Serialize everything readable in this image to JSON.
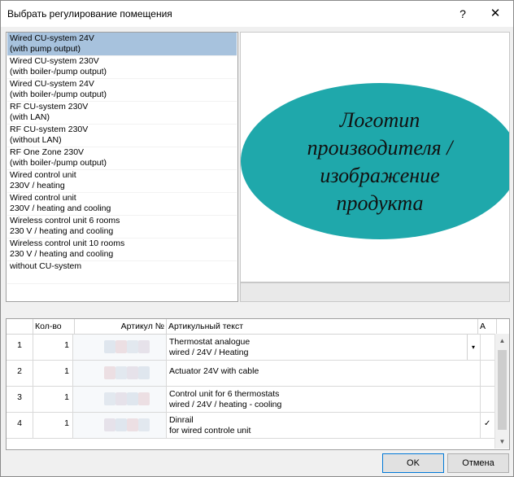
{
  "window": {
    "title": "Выбрать регулирование помещения",
    "help_glyph": "?",
    "close_glyph": "✕"
  },
  "list": {
    "items": [
      {
        "line1": "Wired CU-system 24V",
        "line2": "(with pump output)",
        "selected": true
      },
      {
        "line1": "Wired CU-system 230V",
        "line2": "(with boiler-/pump output)"
      },
      {
        "line1": "Wired CU-system 24V",
        "line2": "(with boiler-/pump output)"
      },
      {
        "line1": "RF CU-system 230V",
        "line2": "(with LAN)"
      },
      {
        "line1": "RF CU-system 230V",
        "line2": "(without LAN)"
      },
      {
        "line1": "RF One Zone 230V",
        "line2": "(with boiler-/pump output)"
      },
      {
        "line1": "Wired control unit",
        "line2": "230V / heating"
      },
      {
        "line1": "Wired control unit",
        "line2": "230V / heating and cooling"
      },
      {
        "line1": "Wireless control unit 6 rooms",
        "line2": "230 V / heating and cooling"
      },
      {
        "line1": "Wireless control unit 10 rooms",
        "line2": "230 V / heating and cooling"
      },
      {
        "line1": "without CU-system",
        "line2": ""
      }
    ]
  },
  "logo": {
    "lines": [
      "Логотип",
      "производителя /",
      "изображение",
      "продукта"
    ],
    "fill": "#1fa8ab"
  },
  "grid": {
    "headers": {
      "num": "",
      "qty": "Кол-во",
      "article": "Артикул №",
      "text": "Артикульный текст",
      "a": "A"
    },
    "rows": [
      {
        "num": "1",
        "qty": "1",
        "text1": "Thermostat analogue",
        "text2": "wired / 24V / Heating",
        "dropdown": "▾"
      },
      {
        "num": "2",
        "qty": "1",
        "text1": "Actuator 24V with cable",
        "text2": ""
      },
      {
        "num": "3",
        "qty": "1",
        "text1": "Control unit for 6 thermostats",
        "text2": "wired / 24V / heating - cooling"
      },
      {
        "num": "4",
        "qty": "1",
        "text1": "Dinrail",
        "text2": "for wired controle unit",
        "check": "✓"
      }
    ]
  },
  "buttons": {
    "ok": "OK",
    "cancel": "Отмена"
  },
  "colors": {
    "selection": "#a7c2dd",
    "logo_fill": "#1fa8ab",
    "focus_border": "#0078d7"
  }
}
